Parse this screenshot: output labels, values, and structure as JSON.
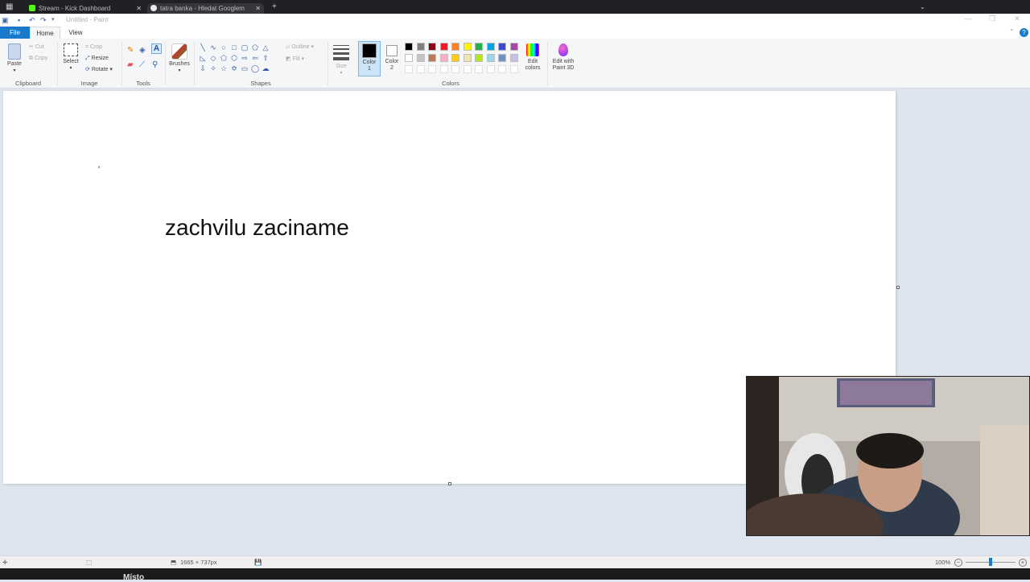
{
  "browser": {
    "tabs": [
      {
        "label": "Stream - Kick Dashboard",
        "active": false
      },
      {
        "label": "tatra banka - Hledat Googlem",
        "active": true
      }
    ],
    "new_tab_symbol": "+"
  },
  "window": {
    "title": "Untitled - Paint"
  },
  "ribbon_tabs": {
    "file": "File",
    "home": "Home",
    "view": "View"
  },
  "ribbon": {
    "clipboard": {
      "paste": "Paste",
      "cut": "Cut",
      "copy": "Copy",
      "label": "Clipboard"
    },
    "image": {
      "select": "Select",
      "crop": "Crop",
      "resize": "Resize",
      "rotate": "Rotate",
      "label": "Image"
    },
    "tools": {
      "label": "Tools"
    },
    "brushes": {
      "label": "Brushes"
    },
    "shapes": {
      "outline": "Outline",
      "fill": "Fill",
      "label": "Shapes"
    },
    "size": {
      "label": "Size"
    },
    "color1": {
      "line1": "Color",
      "line2": "1"
    },
    "color2": {
      "line1": "Color",
      "line2": "2"
    },
    "colors": {
      "label": "Colors"
    },
    "edit_colors": {
      "line1": "Edit",
      "line2": "colors"
    },
    "paint3d": {
      "line1": "Edit with",
      "line2": "Paint 3D"
    }
  },
  "palette": {
    "row1": [
      "#000000",
      "#7f7f7f",
      "#880015",
      "#ed1c24",
      "#ff7f27",
      "#fff200",
      "#22b14c",
      "#00a2e8",
      "#3f48cc",
      "#a349a4"
    ],
    "row2": [
      "#ffffff",
      "#c3c3c3",
      "#b97a57",
      "#ffaec9",
      "#ffc90e",
      "#efe4b0",
      "#b5e61d",
      "#99d9ea",
      "#7092be",
      "#c8bfe7"
    ],
    "row3_empty": 10
  },
  "canvas": {
    "text": "zachvilu zaciname",
    "stray_mark": "'"
  },
  "statusbar": {
    "dimensions": "1665 × 737px",
    "zoom": "100%"
  },
  "taskbar": {
    "label": "Místo"
  }
}
